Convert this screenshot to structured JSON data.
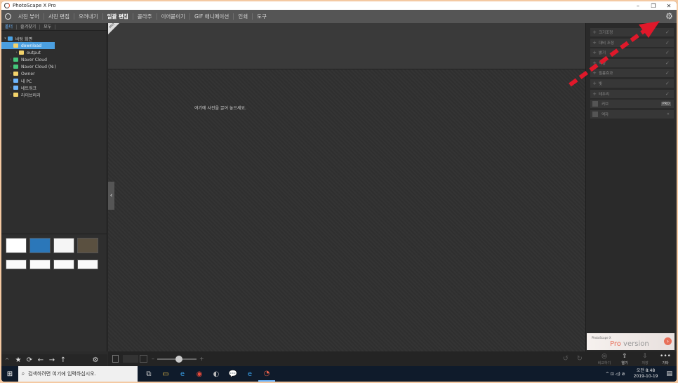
{
  "window": {
    "title": "PhotoScape X Pro",
    "minimize": "–",
    "restore": "❐",
    "close": "✕"
  },
  "menu": [
    {
      "label": "사진 뷰어",
      "active": false
    },
    {
      "label": "사진 편집",
      "active": false
    },
    {
      "label": "오려내기",
      "active": false
    },
    {
      "label": "일괄 편집",
      "active": true
    },
    {
      "label": "콜라주",
      "active": false
    },
    {
      "label": "이어붙이기",
      "active": false
    },
    {
      "label": "GIF 애니메이션",
      "active": false
    },
    {
      "label": "인쇄",
      "active": false
    },
    {
      "label": "도구",
      "active": false
    }
  ],
  "left": {
    "tabs": [
      "폴더",
      "즐겨찾기",
      "모두"
    ],
    "tree": [
      {
        "label": "바탕 화면",
        "indent": 0,
        "caret": "▾",
        "color": "#4aa3e6",
        "selected": false
      },
      {
        "label": "download",
        "indent": 1,
        "caret": "",
        "color": "#f3d36b",
        "selected": true
      },
      {
        "label": "output",
        "indent": 2,
        "caret": "›",
        "color": "#f3d36b",
        "selected": false
      },
      {
        "label": "Naver Cloud",
        "indent": 1,
        "caret": "›",
        "color": "#44c77b",
        "selected": false
      },
      {
        "label": "Naver Cloud (N:)",
        "indent": 1,
        "caret": "›",
        "color": "#44c77b",
        "selected": false
      },
      {
        "label": "Owner",
        "indent": 1,
        "caret": "›",
        "color": "#f3d36b",
        "selected": false
      },
      {
        "label": "내 PC",
        "indent": 1,
        "caret": "›",
        "color": "#6fb7ff",
        "selected": false
      },
      {
        "label": "네트워크",
        "indent": 1,
        "caret": "›",
        "color": "#6fb7ff",
        "selected": false
      },
      {
        "label": "라이브러리",
        "indent": 1,
        "caret": "›",
        "color": "#f3d36b",
        "selected": false
      }
    ],
    "toolbar_icons": [
      "★",
      "⟳",
      "←",
      "→",
      "↑",
      "⚙"
    ]
  },
  "center": {
    "pro_badge": "PRO",
    "drop_hint": "여기에 사진을 끌어 놓으세요."
  },
  "right": {
    "rows": [
      {
        "kind": "plus",
        "label": "크기조정"
      },
      {
        "kind": "plus",
        "label": "대비 조정"
      },
      {
        "kind": "plus",
        "label": "밝기"
      },
      {
        "kind": "plus",
        "label": "색상"
      },
      {
        "kind": "plus",
        "label": "필름효과"
      },
      {
        "kind": "plus",
        "label": "빛"
      },
      {
        "kind": "plus",
        "label": "테두리"
      },
      {
        "kind": "box",
        "label": "커브",
        "tag": "PRO"
      },
      {
        "kind": "box",
        "label": "액자",
        "tag": "✕"
      }
    ],
    "promo_line1": "PhotoScape X",
    "promo_line2a": "Pro",
    "promo_line2b": " version",
    "promo_arrow": "›",
    "bottom": [
      {
        "icon": "◎",
        "label": "비교하기"
      },
      {
        "icon": "⇪",
        "label": "열기"
      },
      {
        "icon": "⇩",
        "label": "저장"
      },
      {
        "icon": "•••",
        "label": "기타"
      }
    ]
  },
  "taskbar": {
    "start_icon": "⊞",
    "search_placeholder": "검색하려면 여기에 입력하십시오.",
    "apps": [
      "⧉",
      "▭",
      "e",
      "◉",
      "◐",
      "💬",
      "e",
      "◔"
    ],
    "tray": "^  ⊡  ◁)  ⊘",
    "time_line1": "오전 8:48",
    "time_line2": "2019-10-19",
    "notif_icon": "▤"
  },
  "colors": {
    "annotation": "#e0182a",
    "selection": "#4b9fe0"
  }
}
